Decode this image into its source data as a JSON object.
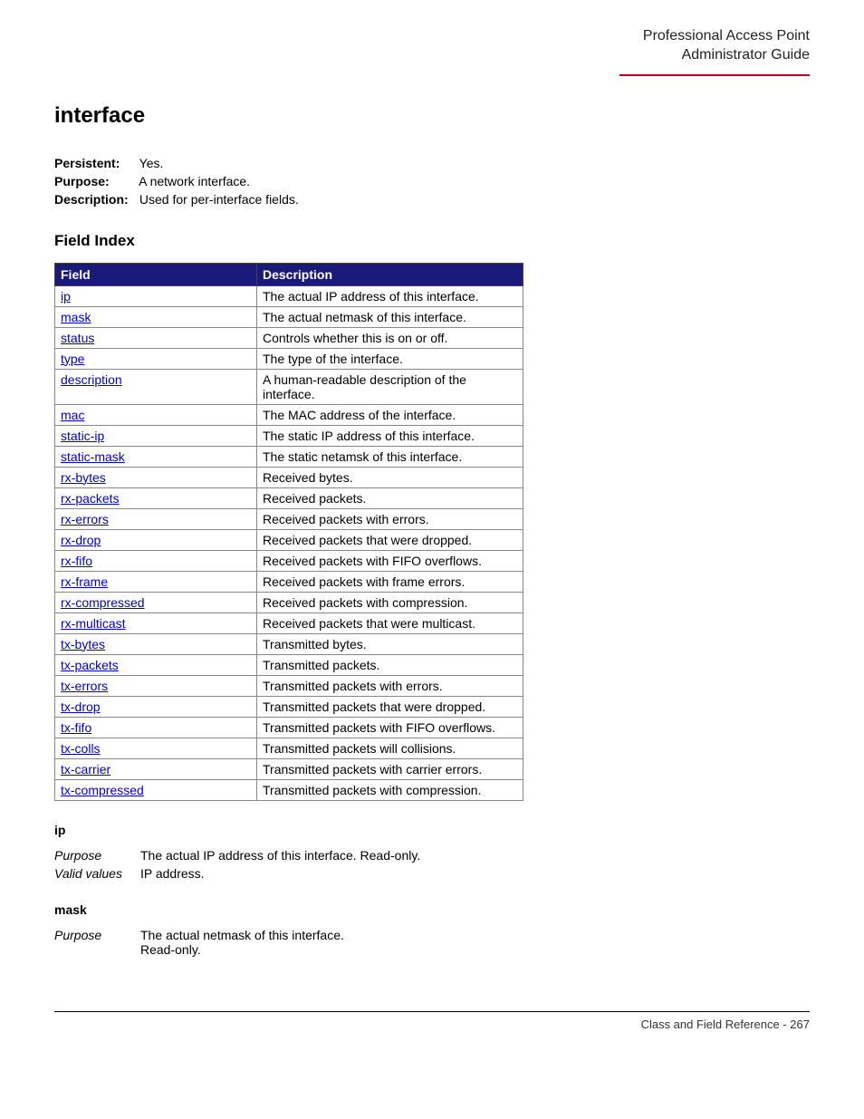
{
  "header": {
    "line1": "Professional Access Point",
    "line2": "Administrator Guide"
  },
  "title": "interface",
  "meta": {
    "persistent_label": "Persistent",
    "persistent_value": "Yes.",
    "purpose_label": "Purpose",
    "purpose_value": "A network interface.",
    "description_label": "Description",
    "description_value": "Used for per-interface fields."
  },
  "fieldindex": {
    "heading": "Field Index",
    "col_field": "Field",
    "col_desc": "Description",
    "rows": [
      {
        "field": "ip",
        "desc": "The actual IP address of this interface."
      },
      {
        "field": "mask",
        "desc": "The actual netmask of this interface."
      },
      {
        "field": "status",
        "desc": "Controls whether this is on or off."
      },
      {
        "field": "type",
        "desc": "The type of the interface."
      },
      {
        "field": "description",
        "desc": "A human-readable description of the interface."
      },
      {
        "field": "mac",
        "desc": "The MAC address of the interface."
      },
      {
        "field": "static-ip",
        "desc": "The static IP address of this interface."
      },
      {
        "field": "static-mask",
        "desc": "The static netamsk of this interface."
      },
      {
        "field": "rx-bytes",
        "desc": "Received bytes."
      },
      {
        "field": "rx-packets",
        "desc": "Received packets."
      },
      {
        "field": "rx-errors",
        "desc": "Received packets with errors."
      },
      {
        "field": "rx-drop",
        "desc": "Received packets that were dropped."
      },
      {
        "field": "rx-fifo",
        "desc": "Received packets with FIFO overflows."
      },
      {
        "field": "rx-frame",
        "desc": "Received packets with frame errors."
      },
      {
        "field": "rx-compressed",
        "desc": "Received packets with compression."
      },
      {
        "field": "rx-multicast",
        "desc": "Received packets that were multicast."
      },
      {
        "field": "tx-bytes",
        "desc": "Transmitted bytes."
      },
      {
        "field": "tx-packets",
        "desc": "Transmitted packets."
      },
      {
        "field": "tx-errors",
        "desc": "Transmitted packets with errors."
      },
      {
        "field": "tx-drop",
        "desc": "Transmitted packets that were dropped."
      },
      {
        "field": "tx-fifo",
        "desc": "Transmitted packets with FIFO overflows."
      },
      {
        "field": "tx-colls",
        "desc": "Transmitted packets will collisions."
      },
      {
        "field": "tx-carrier",
        "desc": "Transmitted packets with carrier errors."
      },
      {
        "field": "tx-compressed",
        "desc": "Transmitted packets with compression."
      }
    ]
  },
  "details": {
    "ip": {
      "heading": "ip",
      "purpose_label": "Purpose",
      "purpose_value": "The actual IP address of this interface. Read-only.",
      "valid_label": "Valid values",
      "valid_value": "IP address."
    },
    "mask": {
      "heading": "mask",
      "purpose_label": "Purpose",
      "purpose_line1": "The actual netmask of this interface.",
      "purpose_line2": "Read-only."
    }
  },
  "footer": {
    "text": "Class and Field Reference - 267"
  }
}
